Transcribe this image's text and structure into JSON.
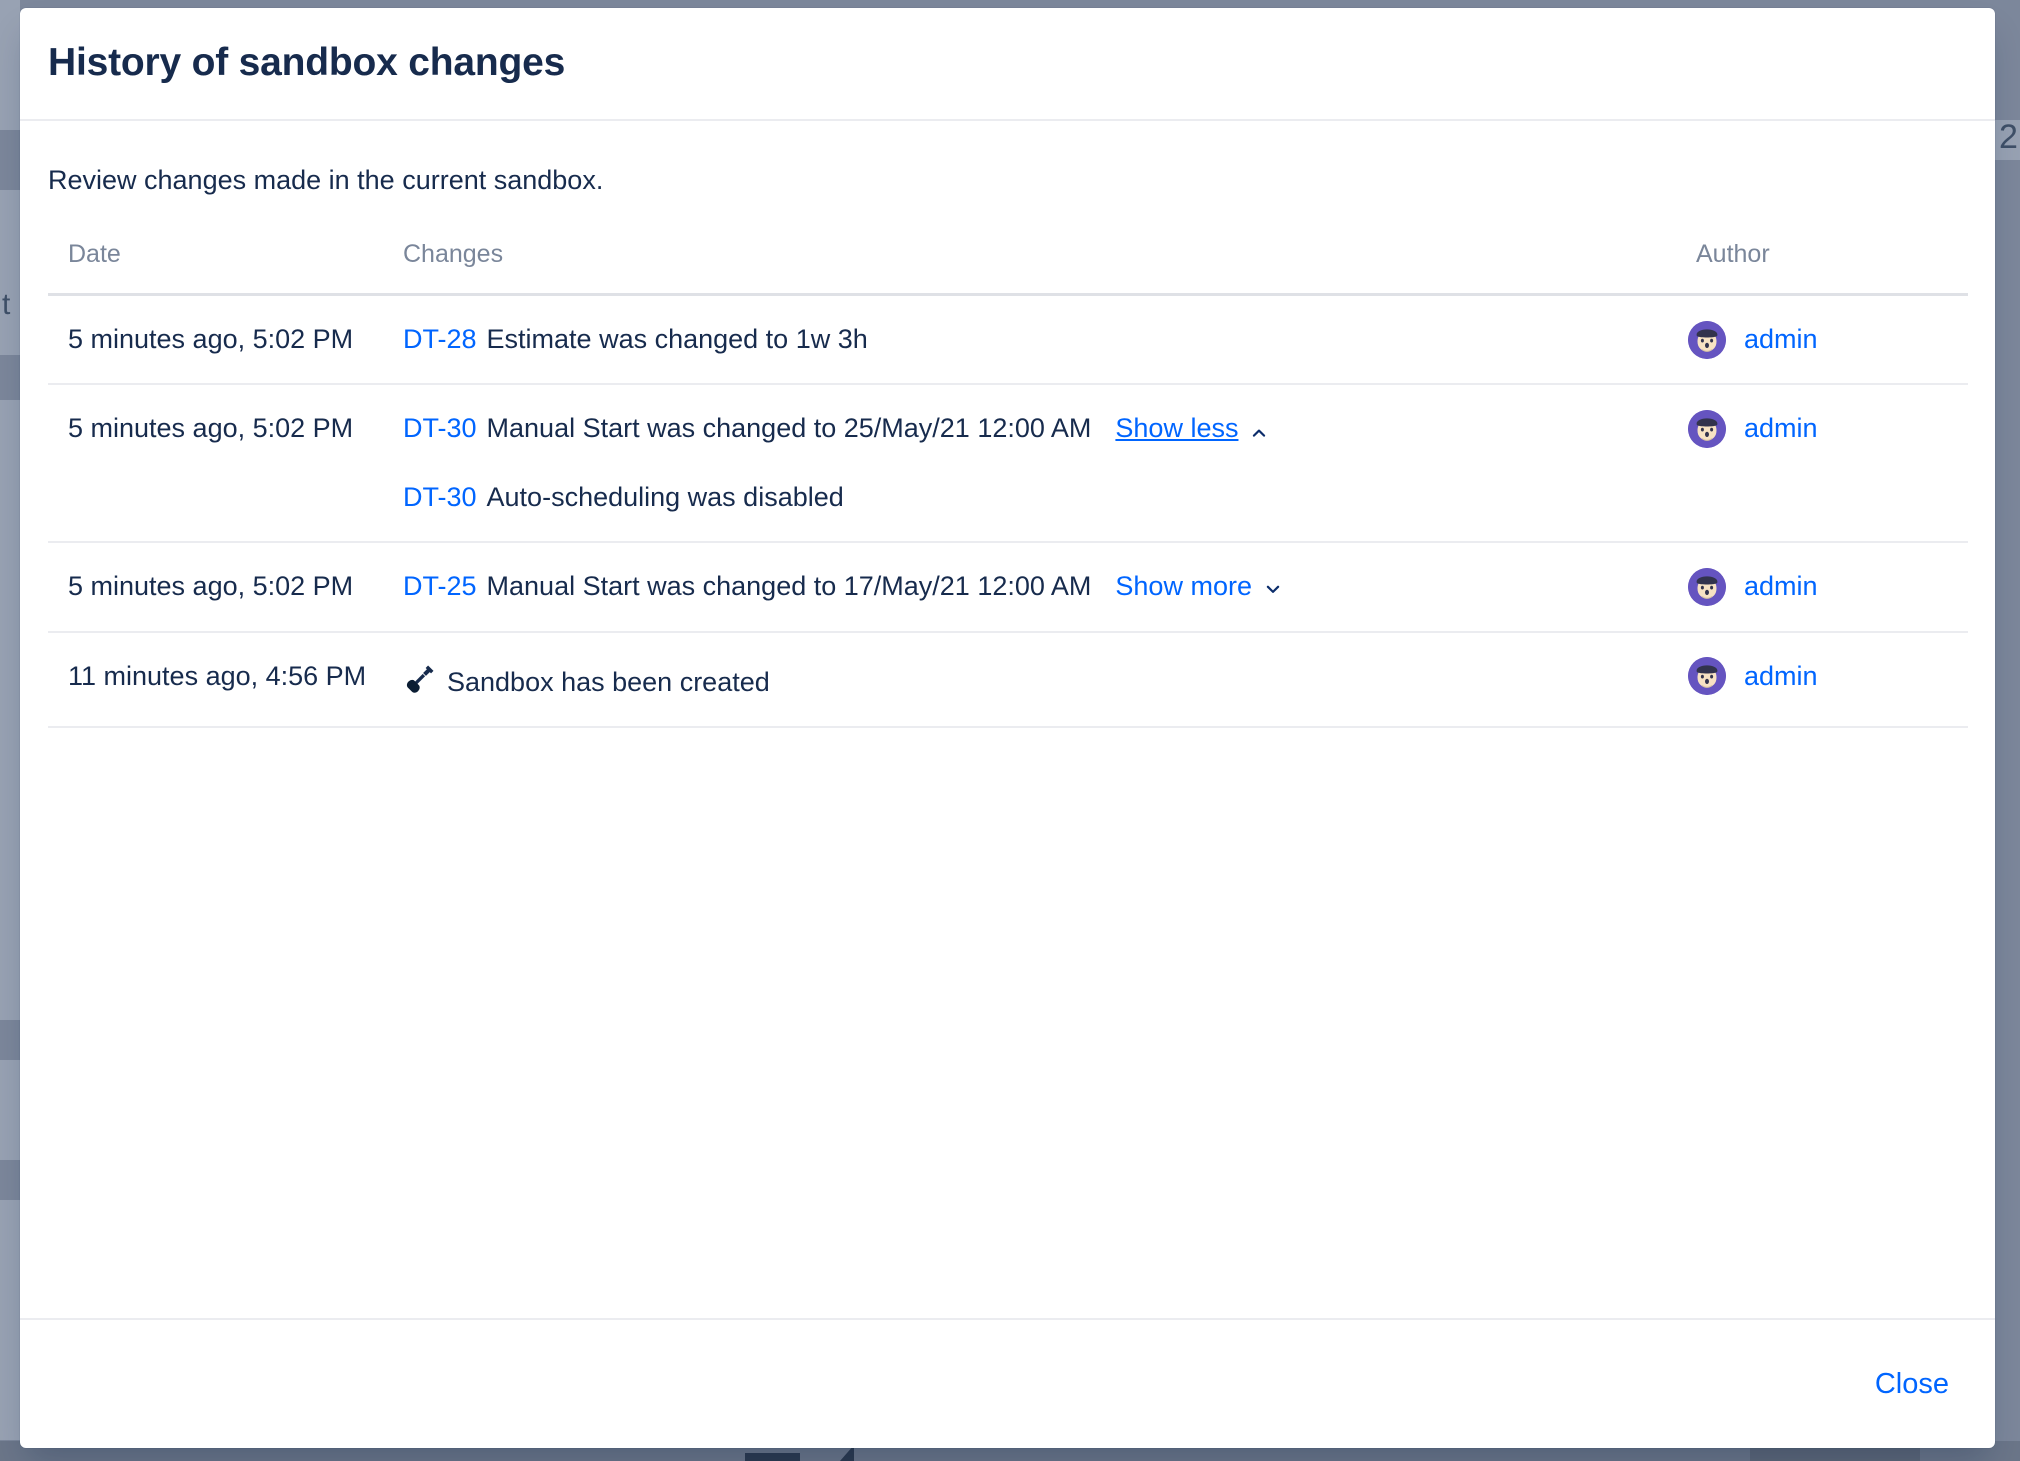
{
  "background": {
    "ghost_text_left": "t",
    "ghost_text_right": "2"
  },
  "dialog": {
    "title": "History of sandbox changes",
    "intro": "Review changes made in the current sandbox.",
    "close_label": "Close"
  },
  "table": {
    "columns": [
      "Date",
      "Changes",
      "Author"
    ],
    "rows": [
      {
        "date": "5 minutes ago, 5:02 PM",
        "icon": "",
        "changes": [
          {
            "issue": "DT-28",
            "text": "Estimate was changed to 1w 3h"
          }
        ],
        "toggle": null,
        "author": "admin"
      },
      {
        "date": "5 minutes ago, 5:02 PM",
        "icon": "",
        "changes": [
          {
            "issue": "DT-30",
            "text": "Manual Start was changed to 25/May/21 12:00 AM"
          },
          {
            "issue": "DT-30",
            "text": "Auto-scheduling was disabled"
          }
        ],
        "toggle": {
          "label": "Show less",
          "direction": "up",
          "hovered": true
        },
        "author": "admin"
      },
      {
        "date": "5 minutes ago, 5:02 PM",
        "icon": "",
        "changes": [
          {
            "issue": "DT-25",
            "text": "Manual Start was changed to 17/May/21 12:00 AM"
          }
        ],
        "toggle": {
          "label": "Show more",
          "direction": "down",
          "hovered": false
        },
        "author": "admin"
      },
      {
        "date": "11 minutes ago, 4:56 PM",
        "icon": "shovel-icon",
        "changes": [
          {
            "issue": "",
            "text": "Sandbox has been created"
          }
        ],
        "toggle": null,
        "author": "admin"
      }
    ]
  },
  "colors": {
    "link": "#0065ff",
    "text": "#172b4d",
    "muted": "#7a869a",
    "divider": "#ebecf0",
    "backdrop": "#7c879b",
    "avatar_bg": "#6554c0"
  }
}
